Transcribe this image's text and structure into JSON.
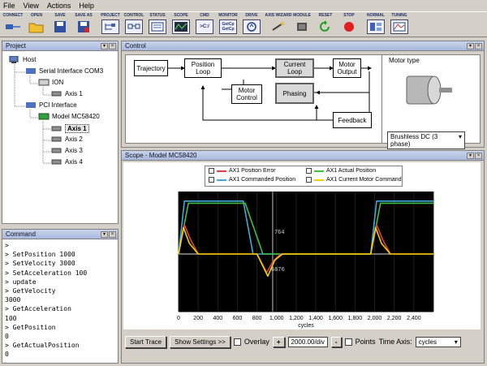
{
  "menu": [
    "File",
    "View",
    "Actions",
    "Help"
  ],
  "toolbar": [
    {
      "label": "CONNECT",
      "icon": "connect-icon"
    },
    {
      "label": "OPEN",
      "icon": "folder-icon"
    },
    {
      "label": "SAVE",
      "icon": "save-icon"
    },
    {
      "label": "SAVE AS",
      "icon": "save-as-icon"
    },
    {
      "label": "PROJECT",
      "icon": "project-icon"
    },
    {
      "label": "CONTROL",
      "icon": "control-icon"
    },
    {
      "label": "STATUS",
      "icon": "status-icon"
    },
    {
      "label": "SCOPE",
      "icon": "scope-icon"
    },
    {
      "label": "CMD",
      "icon": "cmd-icon"
    },
    {
      "label": "MONITOR",
      "icon": "monitor-icon"
    },
    {
      "label": "DRIVE",
      "icon": "drive-icon"
    },
    {
      "label": "AXIS WIZARD",
      "icon": "axis-wizard-icon"
    },
    {
      "label": "MODULE",
      "icon": "module-icon"
    },
    {
      "label": "RESET",
      "icon": "reset-icon"
    },
    {
      "label": "STOP",
      "icon": "stop-icon"
    },
    {
      "label": "NORMAL",
      "icon": "normal-icon"
    },
    {
      "label": "TUNING",
      "icon": "tuning-icon"
    }
  ],
  "toolbar_glyphs": {
    "cmd": ">C:/",
    "monitor": "GetCp GetCp"
  },
  "project": {
    "title": "Project",
    "tree": [
      {
        "label": "Host"
      },
      {
        "label": "Serial Interface COM3"
      },
      {
        "label": "ION"
      },
      {
        "label": "Axis 1"
      },
      {
        "label": "PCI Interface"
      },
      {
        "label": "Model MC58420"
      },
      {
        "label": "Axis 1",
        "selected": true
      },
      {
        "label": "Axis 2"
      },
      {
        "label": "Axis 3"
      },
      {
        "label": "Axis 4"
      }
    ]
  },
  "command": {
    "title": "Command",
    "lines": [
      ">",
      "> SetPosition 1000",
      "> SetVelocity 3000",
      "> SetAcceleration 100",
      "> update",
      "> GetVelocity",
      "3000",
      "> GetAcceleration",
      "100",
      "> GetPosition",
      "0",
      "> GetActualPosition",
      "0",
      ">"
    ]
  },
  "control": {
    "title": "Control",
    "blocks": {
      "trajectory": "Trajectory",
      "position_loop": "Position Loop",
      "current_loop": "Current Loop",
      "motor_output": "Motor Output",
      "motor_control": "Motor Control",
      "phasing": "Phasing",
      "feedback": "Feedback"
    },
    "motor_type_label": "Motor type",
    "motor_type_value": "Brushless DC (3 phase)"
  },
  "scope": {
    "title": "Scope - Model MC58420",
    "legend": [
      {
        "name": "AX1 Position Error",
        "color": "#e04040"
      },
      {
        "name": "AX1 Actual Position",
        "color": "#40c040"
      },
      {
        "name": "AX1 Commanded Position",
        "color": "#40a8e0"
      },
      {
        "name": "AX1 Current Motor Command",
        "color": "#f0d000"
      }
    ],
    "annotations": [
      {
        "text": "764"
      },
      {
        "text": "6876"
      }
    ],
    "xlabel": "cycles",
    "xticks": [
      "0",
      "200",
      "400",
      "600",
      "800",
      "1,000",
      "1,200",
      "1,400",
      "1,600",
      "1,800",
      "2,000",
      "2,200",
      "2,400"
    ],
    "bottom": {
      "start_trace": "Start Trace",
      "show_settings": "Show Settings >>",
      "overlay": "Overlay",
      "plus": "+",
      "div_value": "2000.00/div",
      "minus": "-",
      "points": "Points",
      "time_axis_label": "Time Axis:",
      "time_axis_value": "cycles"
    }
  },
  "chart_data": {
    "type": "line",
    "xlabel": "cycles",
    "xlim": [
      0,
      2600
    ],
    "series": [
      {
        "name": "AX1 Commanded Position",
        "x": [
          0,
          60,
          660,
          760,
          1960,
          2020,
          2600
        ],
        "y": [
          0,
          1,
          1,
          0,
          0,
          1,
          1
        ]
      },
      {
        "name": "AX1 Actual Position",
        "x": [
          0,
          100,
          680,
          860,
          1960,
          2060,
          2600
        ],
        "y": [
          0,
          0.96,
          0.96,
          0,
          0,
          0.96,
          0.96
        ]
      },
      {
        "name": "AX1 Position Error",
        "x": [
          0,
          60,
          120,
          200,
          800,
          900,
          960,
          1040,
          1960,
          2020,
          2080,
          2160,
          2600
        ],
        "y": [
          0,
          0.55,
          0.28,
          0,
          0,
          -0.35,
          -0.15,
          0,
          0,
          0.55,
          0.28,
          0,
          0
        ]
      },
      {
        "name": "AX1 Current Motor Command",
        "x": [
          0,
          50,
          110,
          200,
          800,
          910,
          980,
          1060,
          1960,
          2010,
          2070,
          2160,
          2600
        ],
        "y": [
          0,
          0.5,
          0.2,
          0,
          0,
          -0.42,
          -0.12,
          0,
          0,
          0.5,
          0.2,
          0,
          0
        ]
      }
    ]
  }
}
